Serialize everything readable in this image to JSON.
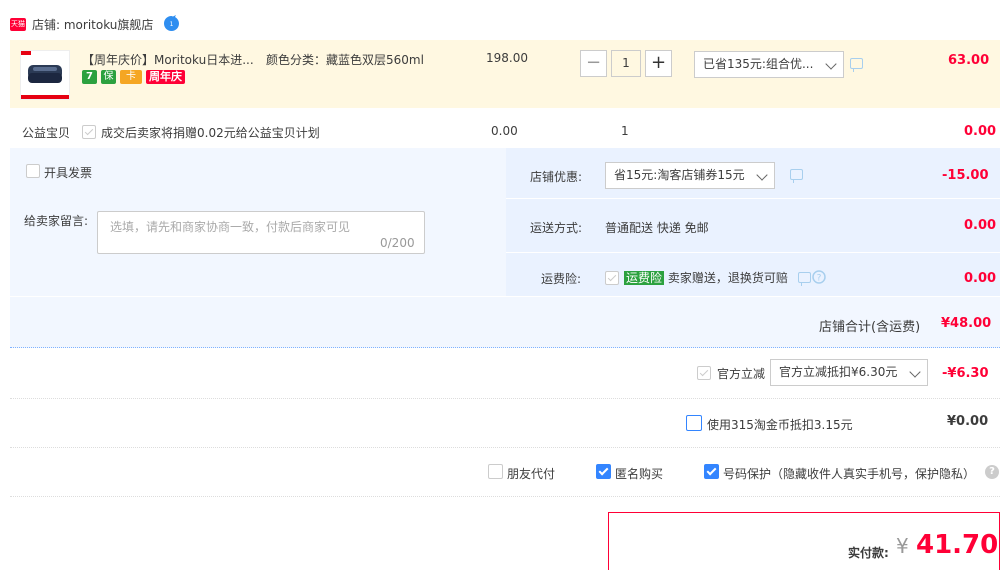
{
  "shop": {
    "label": "店铺: moritoku旗舰店",
    "logo_text": "天猫",
    "chat_icon": "wangwang-chat-icon"
  },
  "item": {
    "title": "【周年庆价】Moritoku日本进...",
    "badges": [
      "7",
      "保",
      "卡",
      "周年庆"
    ],
    "sku": "颜色分类：藏蓝色双层560ml",
    "unit_price": "198.00",
    "qty_minus": "−",
    "quantity": "1",
    "qty_plus": "+",
    "promo_select": "已省135元:组合优...",
    "total": "63.00"
  },
  "charity": {
    "label": "公益宝贝",
    "text": "成交后卖家将捐赠0.02元给公益宝贝计划",
    "price": "0.00",
    "qty": "1",
    "total": "0.00"
  },
  "invoice": {
    "label": "开具发票"
  },
  "message": {
    "label": "给卖家留言:",
    "placeholder": "选填，请先和商家协商一致，付款后商家可见",
    "count": "0/200"
  },
  "shop_discount": {
    "label": "店铺优惠:",
    "select": "省15元:淘客店铺券15元",
    "amount": "-15.00"
  },
  "shipping": {
    "label": "运送方式:",
    "value": "普通配送 快递 免邮",
    "amount": "0.00"
  },
  "insurance": {
    "label": "运费险:",
    "tag": "运费险",
    "text": "卖家赠送，退换货可赔",
    "amount": "0.00"
  },
  "shop_total": {
    "label": "店铺合计(含运费)",
    "amount": "¥48.00"
  },
  "official": {
    "label": "官方立减",
    "select": "官方立减抵扣¥6.30元",
    "amount": "-¥6.30"
  },
  "coins": {
    "label": "使用315淘金币抵扣3.15元",
    "amount": "¥0.00"
  },
  "options": {
    "friend_pay": "朋友代付",
    "anonymous": "匿名购买",
    "number_protect": "号码保护（隐藏收件人真实手机号，保护隐私）"
  },
  "pay": {
    "label": "实付款:",
    "currency": "¥",
    "amount": "41.70"
  },
  "colors": {
    "accent": "#ff0036",
    "panel": "#f2f7ff",
    "check_blue": "#3385ff",
    "green": "#2ca13f"
  }
}
